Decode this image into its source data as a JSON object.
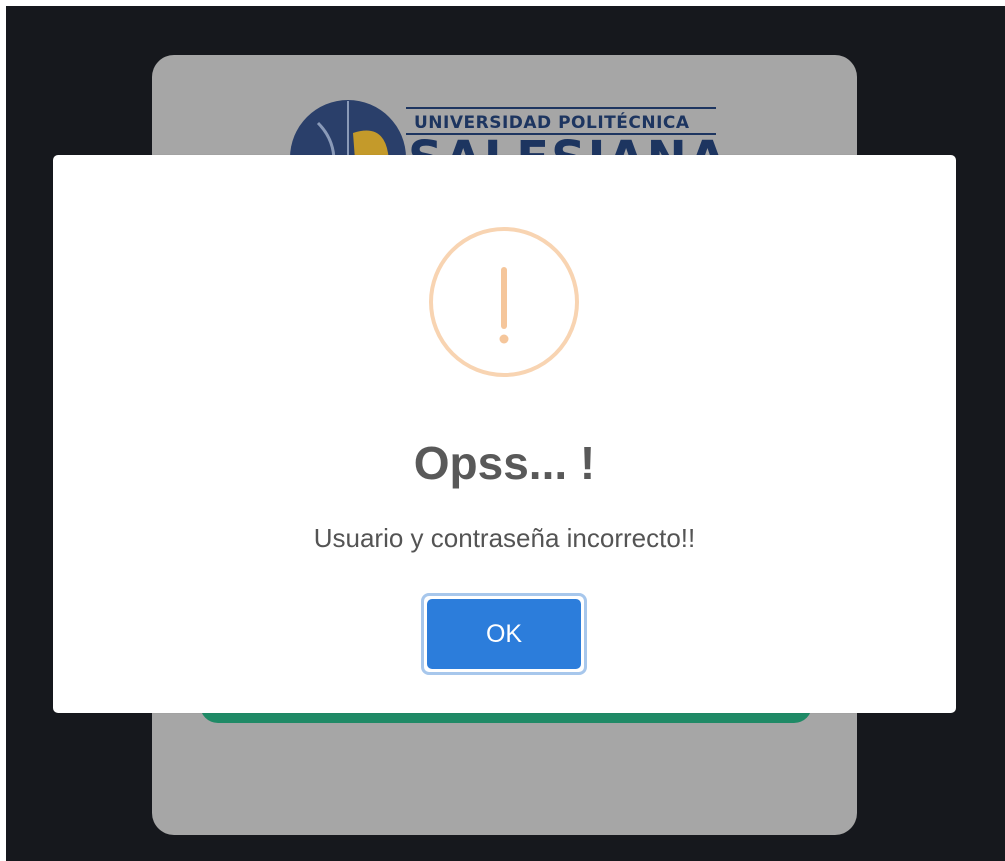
{
  "background": {
    "logo": {
      "line1": "UNIVERSIDAD POLITÉCNICA",
      "line2": "SALESIANA"
    }
  },
  "modal": {
    "icon": "warning-exclamation-icon",
    "title": "Opss... !",
    "text": "Usuario y contraseña incorrecto!!",
    "confirm_label": "OK"
  },
  "colors": {
    "backdrop": "#16181d",
    "card": "#a6a6a6",
    "warning": "#f8bb86",
    "confirm_button": "#2c7ddb",
    "confirm_focus_ring": "#a7c7ec",
    "login_button": "#1f8a66"
  }
}
